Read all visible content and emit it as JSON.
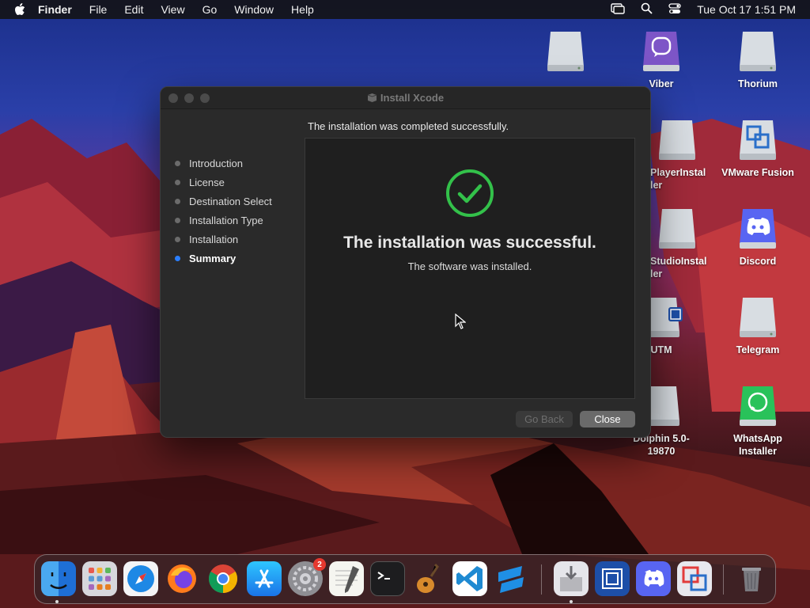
{
  "menubar": {
    "app": "Finder",
    "items": [
      "File",
      "Edit",
      "View",
      "Go",
      "Window",
      "Help"
    ],
    "clock": "Tue Oct 17  1:51 PM"
  },
  "desktop_icons": [
    {
      "label": "Viber",
      "icon": "viber-icon"
    },
    {
      "label": "Thorium",
      "icon": "drive-icon"
    },
    {
      "label": "PlayerInstal ler",
      "icon": "drive-icon"
    },
    {
      "label": "VMware Fusion",
      "icon": "vmware-fusion-icon"
    },
    {
      "label": "StudioInstal ler",
      "icon": "drive-icon"
    },
    {
      "label": "Discord",
      "icon": "discord-icon"
    },
    {
      "label": "UTM",
      "icon": "utm-icon"
    },
    {
      "label": "Telegram",
      "icon": "drive-icon"
    },
    {
      "label": "Dolphin 5.0-19870",
      "icon": "drive-icon"
    },
    {
      "label": "WhatsApp Installer",
      "icon": "whatsapp-icon"
    }
  ],
  "window": {
    "title": "Install Xcode",
    "header": "The installation was completed successfully.",
    "steps": [
      "Introduction",
      "License",
      "Destination Select",
      "Installation Type",
      "Installation",
      "Summary"
    ],
    "active_step": "Summary",
    "success_title": "The installation was successful.",
    "success_sub": "The software was installed.",
    "buttons": {
      "back": "Go Back",
      "close": "Close"
    }
  },
  "dock": {
    "items": [
      "Finder",
      "Launchpad",
      "Safari",
      "Firefox",
      "Chrome",
      "App Store",
      "System Settings",
      "TextEdit",
      "Terminal",
      "GarageBand",
      "Visual Studio Code",
      "Mixed In Key",
      "Installer",
      "UTM",
      "Discord",
      "VMware Fusion",
      "Trash"
    ],
    "settings_badge": "2"
  },
  "colors": {
    "accent": "#2b7fff",
    "success": "#33c14a"
  }
}
